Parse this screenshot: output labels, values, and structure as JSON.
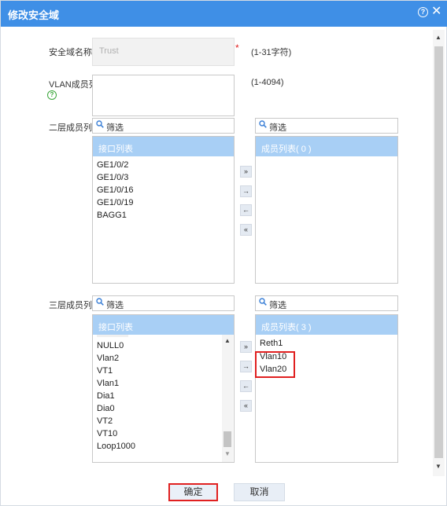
{
  "dialog": {
    "title": "修改安全域"
  },
  "zone_name": {
    "label": "安全域名称",
    "value": "Trust",
    "required_mark": "*",
    "hint": "(1-31字符)"
  },
  "vlan_members": {
    "label": "VLAN成员列表",
    "value": "",
    "hint": "(1-4094)"
  },
  "layer2": {
    "label": "二层成员列表",
    "filter_left": "筛选",
    "filter_right": "筛选",
    "left_header": "接口列表",
    "left_items": [
      "GE1/0/2",
      "GE1/0/3",
      "GE1/0/16",
      "GE1/0/19",
      "BAGG1"
    ],
    "right_header": "成员列表( 0 )",
    "right_items": []
  },
  "layer3": {
    "label": "三层成员列表",
    "filter_left": "筛选",
    "filter_right": "筛选",
    "left_header": "接口列表",
    "left_items": [
      "NULL0",
      "Vlan2",
      "VT1",
      "Vlan1",
      "Dia1",
      "Dia0",
      "VT2",
      "VT10",
      "Loop1000"
    ],
    "right_header": "成员列表( 3 )",
    "right_items": [
      "Reth1",
      "Vlan10",
      "Vlan20"
    ]
  },
  "transfer_buttons": [
    "add-all",
    "add-selected",
    "remove-selected",
    "remove-all"
  ],
  "buttons": {
    "ok": "确定",
    "cancel": "取消"
  },
  "colors": {
    "titlebar": "#3f8fe6",
    "list_header": "#a8cff5",
    "highlight": "#e02020"
  }
}
